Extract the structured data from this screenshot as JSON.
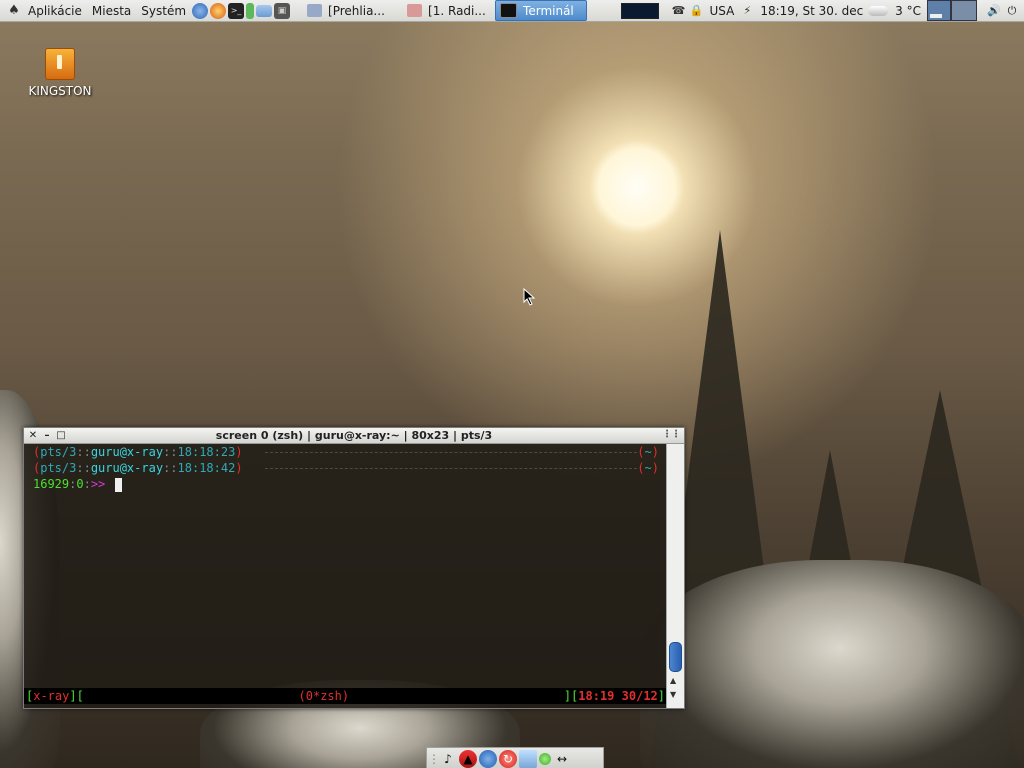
{
  "top_panel": {
    "menus": [
      "Aplikácie",
      "Miesta",
      "Systém"
    ],
    "tasks": [
      {
        "label": "[Prehlia...",
        "active": false
      },
      {
        "label": "[1. Radi...",
        "active": false
      },
      {
        "label": "Terminál",
        "active": true
      }
    ],
    "keyboard_layout": "USA",
    "clock": "18:19, St 30. dec",
    "weather": "3 °C"
  },
  "desktop": {
    "icons": [
      {
        "label": "KINGSTON"
      }
    ]
  },
  "terminal": {
    "title": "screen 0 (zsh) | guru@x-ray:~ | 80x23 | pts/3",
    "lines": [
      {
        "tty": "pts/3",
        "user": "guru@x-ray",
        "time": "18:18:23",
        "dir": "~"
      },
      {
        "tty": "pts/3",
        "user": "guru@x-ray",
        "time": "18:18:42",
        "dir": "~"
      }
    ],
    "prompt": {
      "history": "16929",
      "status": "0",
      "arrows": ">>"
    },
    "status_bar": {
      "host": "x-ray",
      "windows": "(0*zsh)",
      "time": "18:19",
      "date": "30/12"
    }
  },
  "colors": {
    "panel": "#e3e3e0",
    "active_task": "#5a96d6",
    "term_red": "#e0302c",
    "term_cyan": "#3bd3e0",
    "term_green": "#4de02f",
    "term_magenta": "#d63ad6"
  }
}
